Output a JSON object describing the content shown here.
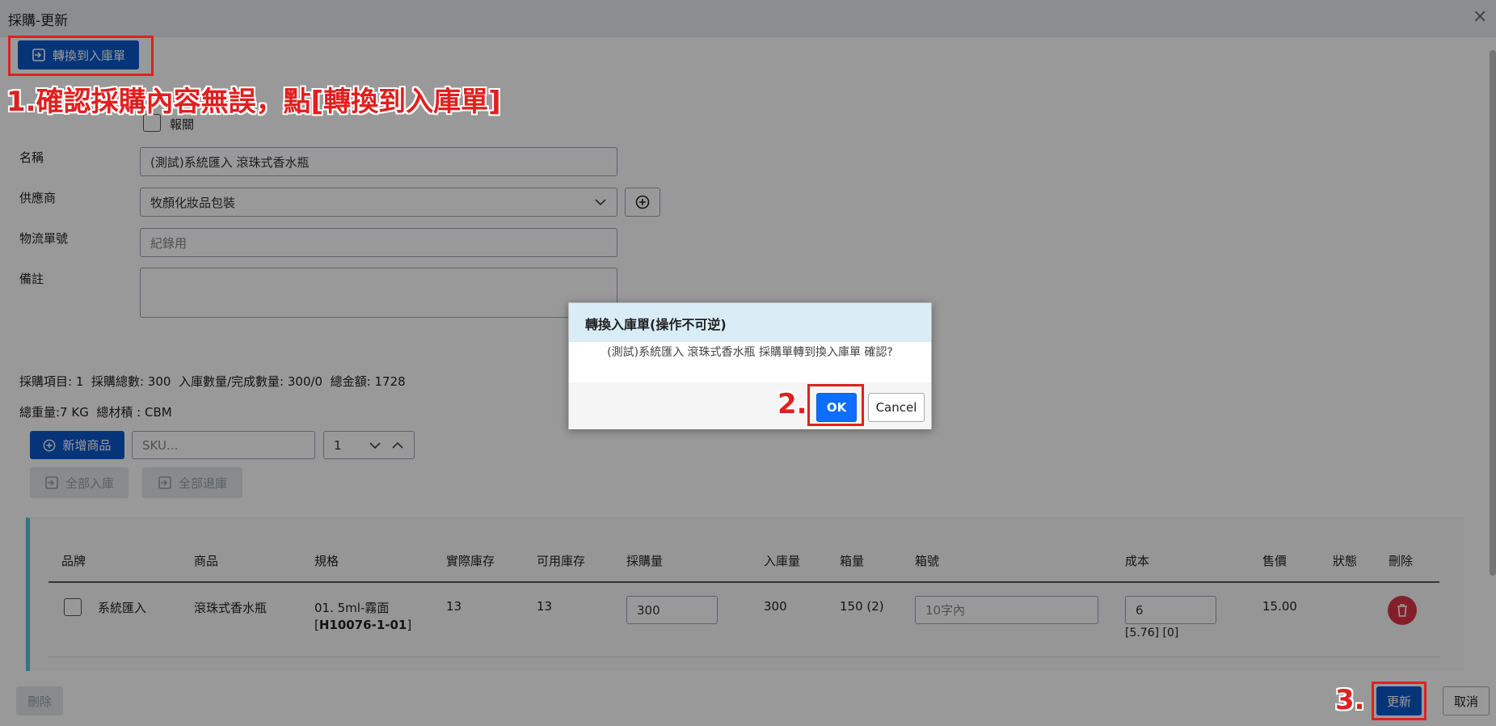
{
  "window": {
    "title": "採購-更新",
    "close_label": "×"
  },
  "toolbar": {
    "convert_label": "轉換到入庫單"
  },
  "form": {
    "customs_label": "報關",
    "name_label": "名稱",
    "name_value": "(測試)系統匯入 滾珠式香水瓶",
    "supplier_label": "供應商",
    "supplier_value": "牧顏化妝品包裝",
    "tracking_label": "物流單號",
    "tracking_placeholder": "紀錄用",
    "note_label": "備註",
    "note_value": ""
  },
  "summary": {
    "line1_items_label": "採購項目:",
    "line1_items_value": "1",
    "line1_total_label": "採購總數:",
    "line1_total_value": "300",
    "line1_inbound_label": "入庫數量/完成數量:",
    "line1_inbound_value": "300/0",
    "line1_amount_label": "總金額:",
    "line1_amount_value": "1728",
    "line2_weight": "總重量:7 KG",
    "line2_volume": "總材積 : CBM"
  },
  "products": {
    "add_label": "新增商品",
    "sku_placeholder": "SKU...",
    "qty_value": "1",
    "all_inbound_label": "全部入庫",
    "all_return_label": "全部退庫"
  },
  "table": {
    "headers": [
      "品牌",
      "商品",
      "規格",
      "實際庫存",
      "可用庫存",
      "採購量",
      "入庫量",
      "箱量",
      "箱號",
      "成本",
      "售價",
      "狀態",
      "刪除"
    ],
    "row": {
      "brand": "系統匯入",
      "product": "滾珠式香水瓶",
      "spec_line1": "01. 5ml-霧面",
      "spec_open": "[",
      "spec_code": "H10076-1-01",
      "spec_close": "]",
      "actual_stock": "13",
      "available_stock": "13",
      "purchase_qty": "300",
      "inbound_qty": "300",
      "box_qty": "150 (2)",
      "box_no_placeholder": "10字內",
      "cost": "6",
      "cost_sub": "[5.76] [0]",
      "price": "15.00"
    }
  },
  "footer": {
    "delete_label": "刪除",
    "update_label": "更新",
    "cancel_label": "取消"
  },
  "dialog": {
    "title": "轉換入庫單(操作不可逆)",
    "message": "(測試)系統匯入 滾珠式香水瓶 採購單轉到換入庫單 確認?",
    "ok_label": "OK",
    "cancel_label": "Cancel"
  },
  "annotations": {
    "step1": "1.確認採購內容無誤，點[轉換到入庫單]",
    "step2": "2.",
    "step3": "3."
  },
  "colors": {
    "primary": "#0d6efd",
    "danger": "#dc3545",
    "annotation": "#e02020",
    "dialog_header": "#d9edf7"
  }
}
